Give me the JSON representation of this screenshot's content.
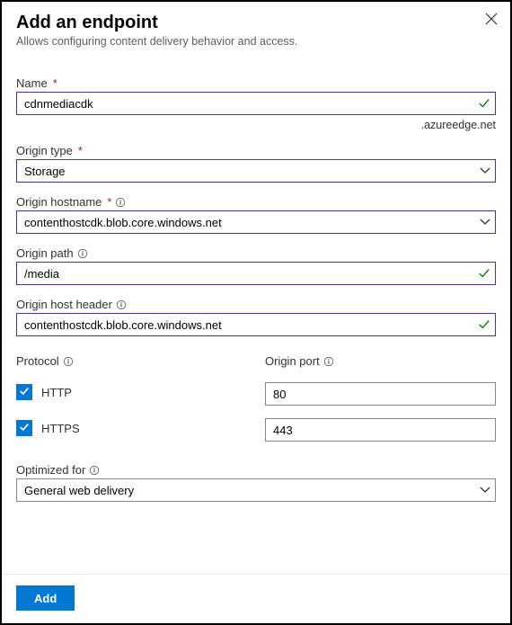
{
  "header": {
    "title": "Add an endpoint",
    "subtitle": "Allows configuring content delivery behavior and access."
  },
  "fields": {
    "name": {
      "label": "Name",
      "value": "cdnmediacdk",
      "suffix": ".azureedge.net"
    },
    "originType": {
      "label": "Origin type",
      "value": "Storage"
    },
    "originHostname": {
      "label": "Origin hostname",
      "value": "contenthostcdk.blob.core.windows.net"
    },
    "originPath": {
      "label": "Origin path",
      "value": "/media"
    },
    "originHostHeader": {
      "label": "Origin host header",
      "value": "contenthostcdk.blob.core.windows.net"
    },
    "protocol": {
      "label": "Protocol",
      "http": "HTTP",
      "https": "HTTPS"
    },
    "originPort": {
      "label": "Origin port",
      "http": "80",
      "https": "443"
    },
    "optimizedFor": {
      "label": "Optimized for",
      "value": "General web delivery"
    }
  },
  "buttons": {
    "add": "Add"
  },
  "colors": {
    "accent": "#0078d4",
    "fieldBorder": "#5b2e87",
    "success": "#107c10",
    "required": "#a4262c"
  }
}
